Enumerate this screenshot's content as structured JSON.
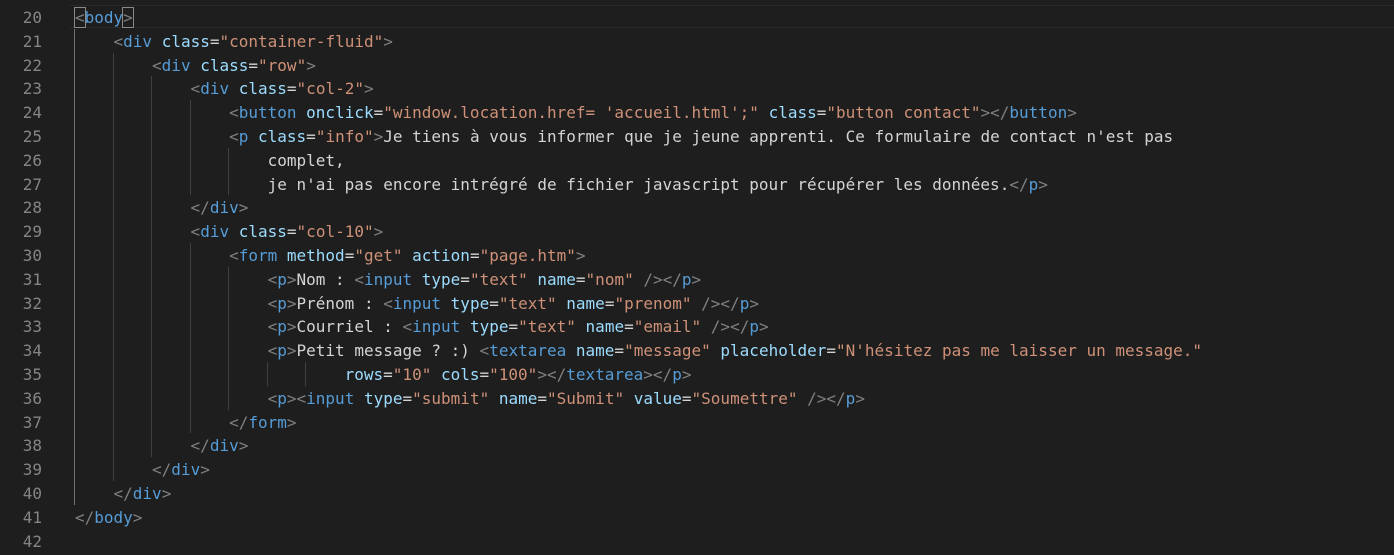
{
  "editor": {
    "language": "html",
    "colors": {
      "background": "#1e1e1e",
      "line_number": "#858585",
      "tag": "#569cd6",
      "bracket": "#808080",
      "attribute": "#9cdcfe",
      "string": "#ce9178",
      "text": "#d4d4d4"
    },
    "lines": [
      {
        "n": "20",
        "indent": 0,
        "tokens": [
          [
            "br",
            "<"
          ],
          [
            "tag",
            "body"
          ],
          [
            "br",
            ">"
          ]
        ]
      },
      {
        "n": "21",
        "indent": 1,
        "tokens": [
          [
            "br",
            "<"
          ],
          [
            "tag",
            "div"
          ],
          [
            "txt",
            " "
          ],
          [
            "attr",
            "class"
          ],
          [
            "txt",
            "="
          ],
          [
            "str",
            "\"container-fluid\""
          ],
          [
            "br",
            ">"
          ]
        ]
      },
      {
        "n": "22",
        "indent": 2,
        "tokens": [
          [
            "br",
            "<"
          ],
          [
            "tag",
            "div"
          ],
          [
            "txt",
            " "
          ],
          [
            "attr",
            "class"
          ],
          [
            "txt",
            "="
          ],
          [
            "str",
            "\"row\""
          ],
          [
            "br",
            ">"
          ]
        ]
      },
      {
        "n": "23",
        "indent": 3,
        "tokens": [
          [
            "br",
            "<"
          ],
          [
            "tag",
            "div"
          ],
          [
            "txt",
            " "
          ],
          [
            "attr",
            "class"
          ],
          [
            "txt",
            "="
          ],
          [
            "str",
            "\"col-2\""
          ],
          [
            "br",
            ">"
          ]
        ]
      },
      {
        "n": "24",
        "indent": 4,
        "tokens": [
          [
            "br",
            "<"
          ],
          [
            "tag",
            "button"
          ],
          [
            "txt",
            " "
          ],
          [
            "attr",
            "onclick"
          ],
          [
            "txt",
            "="
          ],
          [
            "str",
            "\"window.location.href= 'accueil.html';\""
          ],
          [
            "txt",
            " "
          ],
          [
            "attr",
            "class"
          ],
          [
            "txt",
            "="
          ],
          [
            "str",
            "\"button contact\""
          ],
          [
            "br",
            ">"
          ],
          [
            "br",
            "</"
          ],
          [
            "tag",
            "button"
          ],
          [
            "br",
            ">"
          ]
        ]
      },
      {
        "n": "25",
        "indent": 4,
        "tokens": [
          [
            "br",
            "<"
          ],
          [
            "tag",
            "p"
          ],
          [
            "txt",
            " "
          ],
          [
            "attr",
            "class"
          ],
          [
            "txt",
            "="
          ],
          [
            "str",
            "\"info\""
          ],
          [
            "br",
            ">"
          ],
          [
            "txt",
            "Je tiens à vous informer que je jeune apprenti. Ce formulaire de contact n'est pas"
          ]
        ]
      },
      {
        "n": "26",
        "indent": 5,
        "tokens": [
          [
            "txt",
            "complet,"
          ]
        ]
      },
      {
        "n": "27",
        "indent": 5,
        "tokens": [
          [
            "txt",
            "je n'ai pas encore intrégré de fichier javascript pour récupérer les données."
          ],
          [
            "br",
            "</"
          ],
          [
            "tag",
            "p"
          ],
          [
            "br",
            ">"
          ]
        ]
      },
      {
        "n": "28",
        "indent": 3,
        "tokens": [
          [
            "br",
            "</"
          ],
          [
            "tag",
            "div"
          ],
          [
            "br",
            ">"
          ]
        ]
      },
      {
        "n": "29",
        "indent": 3,
        "tokens": [
          [
            "br",
            "<"
          ],
          [
            "tag",
            "div"
          ],
          [
            "txt",
            " "
          ],
          [
            "attr",
            "class"
          ],
          [
            "txt",
            "="
          ],
          [
            "str",
            "\"col-10\""
          ],
          [
            "br",
            ">"
          ]
        ]
      },
      {
        "n": "30",
        "indent": 4,
        "tokens": [
          [
            "br",
            "<"
          ],
          [
            "tag",
            "form"
          ],
          [
            "txt",
            " "
          ],
          [
            "attr",
            "method"
          ],
          [
            "txt",
            "="
          ],
          [
            "str",
            "\"get\""
          ],
          [
            "txt",
            " "
          ],
          [
            "attr",
            "action"
          ],
          [
            "txt",
            "="
          ],
          [
            "str",
            "\"page.htm\""
          ],
          [
            "br",
            ">"
          ]
        ]
      },
      {
        "n": "31",
        "indent": 5,
        "tokens": [
          [
            "br",
            "<"
          ],
          [
            "tag",
            "p"
          ],
          [
            "br",
            ">"
          ],
          [
            "txt",
            "Nom : "
          ],
          [
            "br",
            "<"
          ],
          [
            "tag",
            "input"
          ],
          [
            "txt",
            " "
          ],
          [
            "attr",
            "type"
          ],
          [
            "txt",
            "="
          ],
          [
            "str",
            "\"text\""
          ],
          [
            "txt",
            " "
          ],
          [
            "attr",
            "name"
          ],
          [
            "txt",
            "="
          ],
          [
            "str",
            "\"nom\""
          ],
          [
            "txt",
            " "
          ],
          [
            "br",
            "/>"
          ],
          [
            "br",
            "</"
          ],
          [
            "tag",
            "p"
          ],
          [
            "br",
            ">"
          ]
        ]
      },
      {
        "n": "32",
        "indent": 5,
        "tokens": [
          [
            "br",
            "<"
          ],
          [
            "tag",
            "p"
          ],
          [
            "br",
            ">"
          ],
          [
            "txt",
            "Prénom : "
          ],
          [
            "br",
            "<"
          ],
          [
            "tag",
            "input"
          ],
          [
            "txt",
            " "
          ],
          [
            "attr",
            "type"
          ],
          [
            "txt",
            "="
          ],
          [
            "str",
            "\"text\""
          ],
          [
            "txt",
            " "
          ],
          [
            "attr",
            "name"
          ],
          [
            "txt",
            "="
          ],
          [
            "str",
            "\"prenom\""
          ],
          [
            "txt",
            " "
          ],
          [
            "br",
            "/>"
          ],
          [
            "br",
            "</"
          ],
          [
            "tag",
            "p"
          ],
          [
            "br",
            ">"
          ]
        ]
      },
      {
        "n": "33",
        "indent": 5,
        "tokens": [
          [
            "br",
            "<"
          ],
          [
            "tag",
            "p"
          ],
          [
            "br",
            ">"
          ],
          [
            "txt",
            "Courriel : "
          ],
          [
            "br",
            "<"
          ],
          [
            "tag",
            "input"
          ],
          [
            "txt",
            " "
          ],
          [
            "attr",
            "type"
          ],
          [
            "txt",
            "="
          ],
          [
            "str",
            "\"text\""
          ],
          [
            "txt",
            " "
          ],
          [
            "attr",
            "name"
          ],
          [
            "txt",
            "="
          ],
          [
            "str",
            "\"email\""
          ],
          [
            "txt",
            " "
          ],
          [
            "br",
            "/>"
          ],
          [
            "br",
            "</"
          ],
          [
            "tag",
            "p"
          ],
          [
            "br",
            ">"
          ]
        ]
      },
      {
        "n": "34",
        "indent": 5,
        "tokens": [
          [
            "br",
            "<"
          ],
          [
            "tag",
            "p"
          ],
          [
            "br",
            ">"
          ],
          [
            "txt",
            "Petit message ? :) "
          ],
          [
            "br",
            "<"
          ],
          [
            "tag",
            "textarea"
          ],
          [
            "txt",
            " "
          ],
          [
            "attr",
            "name"
          ],
          [
            "txt",
            "="
          ],
          [
            "str",
            "\"message\""
          ],
          [
            "txt",
            " "
          ],
          [
            "attr",
            "placeholder"
          ],
          [
            "txt",
            "="
          ],
          [
            "str",
            "\"N'hésitez pas me laisser un message.\""
          ]
        ]
      },
      {
        "n": "35",
        "indent": 7,
        "tokens": [
          [
            "attr",
            "rows"
          ],
          [
            "txt",
            "="
          ],
          [
            "str",
            "\"10\""
          ],
          [
            "txt",
            " "
          ],
          [
            "attr",
            "cols"
          ],
          [
            "txt",
            "="
          ],
          [
            "str",
            "\"100\""
          ],
          [
            "br",
            ">"
          ],
          [
            "br",
            "</"
          ],
          [
            "tag",
            "textarea"
          ],
          [
            "br",
            ">"
          ],
          [
            "br",
            "</"
          ],
          [
            "tag",
            "p"
          ],
          [
            "br",
            ">"
          ]
        ]
      },
      {
        "n": "36",
        "indent": 5,
        "tokens": [
          [
            "br",
            "<"
          ],
          [
            "tag",
            "p"
          ],
          [
            "br",
            ">"
          ],
          [
            "br",
            "<"
          ],
          [
            "tag",
            "input"
          ],
          [
            "txt",
            " "
          ],
          [
            "attr",
            "type"
          ],
          [
            "txt",
            "="
          ],
          [
            "str",
            "\"submit\""
          ],
          [
            "txt",
            " "
          ],
          [
            "attr",
            "name"
          ],
          [
            "txt",
            "="
          ],
          [
            "str",
            "\"Submit\""
          ],
          [
            "txt",
            " "
          ],
          [
            "attr",
            "value"
          ],
          [
            "txt",
            "="
          ],
          [
            "str",
            "\"Soumettre\""
          ],
          [
            "txt",
            " "
          ],
          [
            "br",
            "/>"
          ],
          [
            "br",
            "</"
          ],
          [
            "tag",
            "p"
          ],
          [
            "br",
            ">"
          ]
        ]
      },
      {
        "n": "37",
        "indent": 4,
        "tokens": [
          [
            "br",
            "</"
          ],
          [
            "tag",
            "form"
          ],
          [
            "br",
            ">"
          ]
        ]
      },
      {
        "n": "38",
        "indent": 3,
        "tokens": [
          [
            "br",
            "</"
          ],
          [
            "tag",
            "div"
          ],
          [
            "br",
            ">"
          ]
        ]
      },
      {
        "n": "39",
        "indent": 2,
        "tokens": [
          [
            "br",
            "</"
          ],
          [
            "tag",
            "div"
          ],
          [
            "br",
            ">"
          ]
        ]
      },
      {
        "n": "40",
        "indent": 1,
        "tokens": [
          [
            "br",
            "</"
          ],
          [
            "tag",
            "div"
          ],
          [
            "br",
            ">"
          ]
        ]
      },
      {
        "n": "41",
        "indent": 0,
        "tokens": [
          [
            "br",
            "</"
          ],
          [
            "tag",
            "body"
          ],
          [
            "br",
            ">"
          ]
        ]
      },
      {
        "n": "42",
        "indent": 0,
        "tokens": []
      }
    ]
  }
}
